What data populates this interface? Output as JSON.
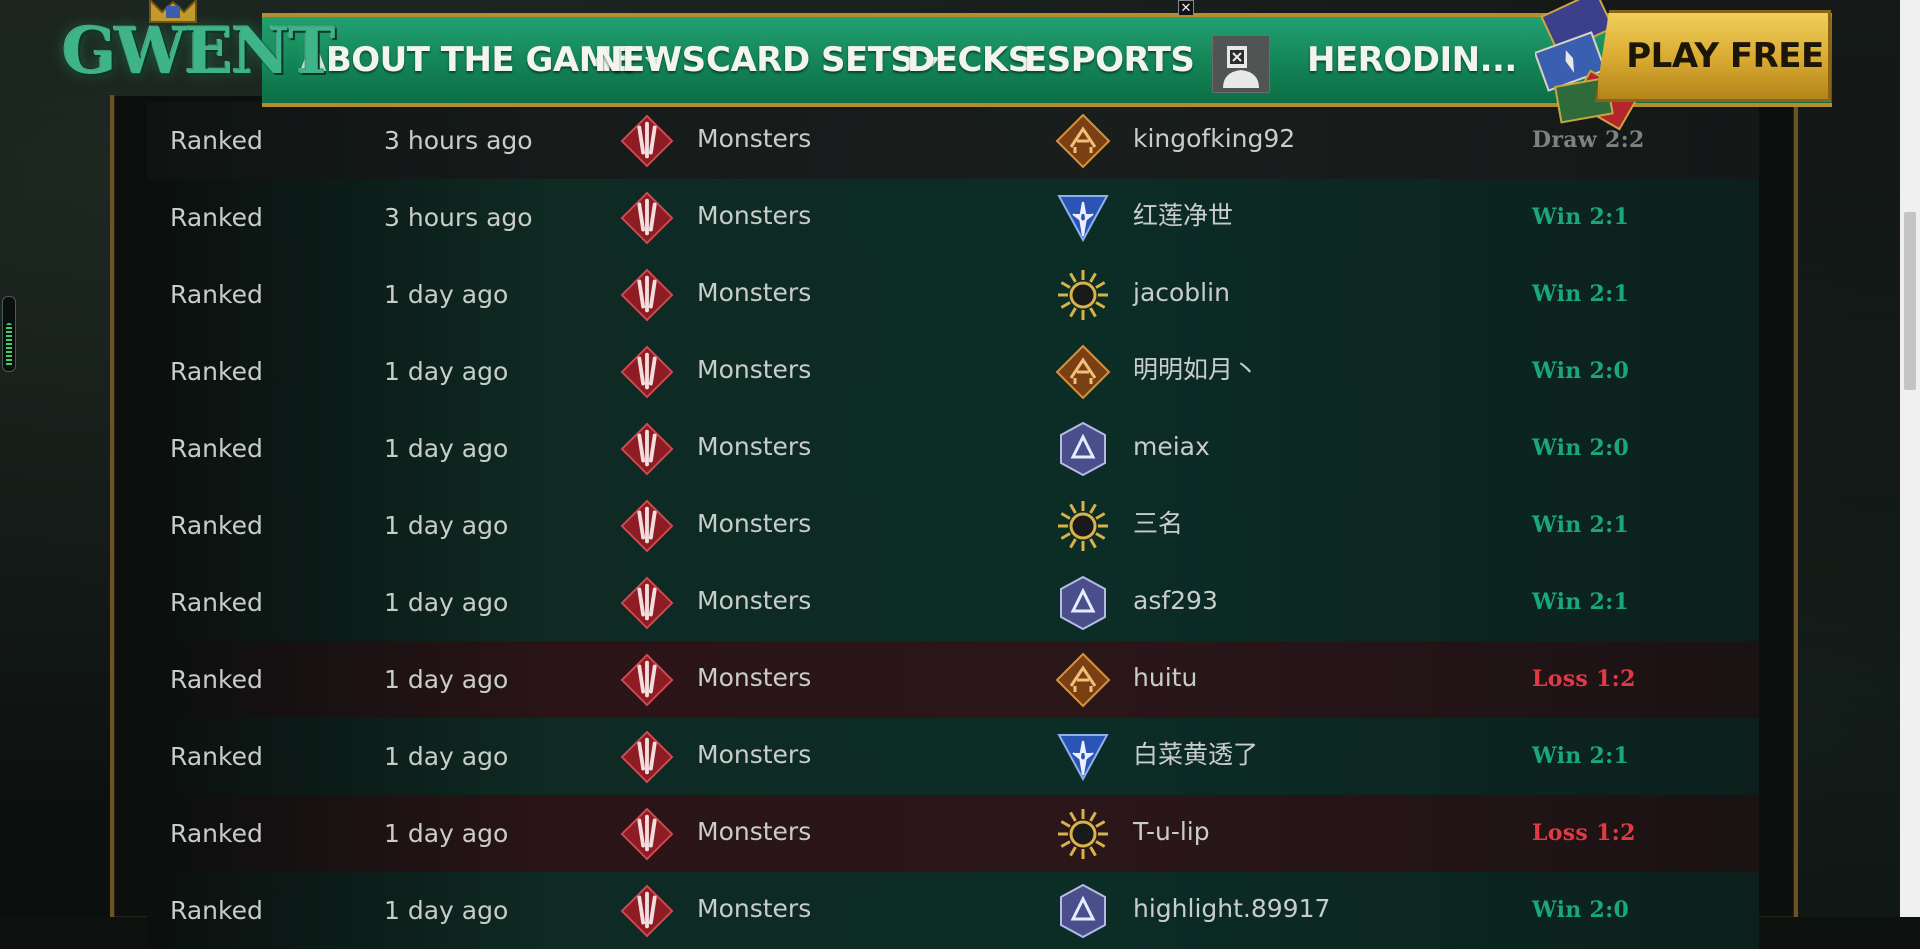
{
  "nav": {
    "logo": "GWENT",
    "items": [
      {
        "label": "ABOUT THE GAME",
        "dropdown": true
      },
      {
        "label": "NEWS",
        "dropdown": false
      },
      {
        "label": "CARD SETS",
        "dropdown": true
      },
      {
        "label": "DECKS",
        "dropdown": false
      },
      {
        "label": "ESPORTS",
        "dropdown": false
      }
    ],
    "username": "HERODIN...",
    "play_label": "PLAY FREE",
    "close_glyph": "✕"
  },
  "colors": {
    "nav_green": "#138455",
    "gold": "#d8a930",
    "win": "#1ba77e",
    "loss": "#e23a45",
    "draw": "#7d8380"
  },
  "matches": [
    {
      "mode": "Ranked",
      "time": "3 hours ago",
      "faction": "Monsters",
      "faction_icon": "monsters-icon",
      "opponent": "kingofking92",
      "opponent_icon": "syndicate-icon",
      "result": "Draw 2:2",
      "outcome": "draw"
    },
    {
      "mode": "Ranked",
      "time": "3 hours ago",
      "faction": "Monsters",
      "faction_icon": "monsters-icon",
      "opponent": "红莲净世",
      "opponent_icon": "northern-realms-icon",
      "result": "Win 2:1",
      "outcome": "win"
    },
    {
      "mode": "Ranked",
      "time": "1 day ago",
      "faction": "Monsters",
      "faction_icon": "monsters-icon",
      "opponent": "jacoblin",
      "opponent_icon": "nilfgaard-icon",
      "result": "Win 2:1",
      "outcome": "win"
    },
    {
      "mode": "Ranked",
      "time": "1 day ago",
      "faction": "Monsters",
      "faction_icon": "monsters-icon",
      "opponent": "明明如月丶",
      "opponent_icon": "syndicate-icon",
      "result": "Win 2:0",
      "outcome": "win"
    },
    {
      "mode": "Ranked",
      "time": "1 day ago",
      "faction": "Monsters",
      "faction_icon": "monsters-icon",
      "opponent": "meiax",
      "opponent_icon": "skellige-icon",
      "result": "Win 2:0",
      "outcome": "win"
    },
    {
      "mode": "Ranked",
      "time": "1 day ago",
      "faction": "Monsters",
      "faction_icon": "monsters-icon",
      "opponent": "三名",
      "opponent_icon": "nilfgaard-icon",
      "result": "Win 2:1",
      "outcome": "win"
    },
    {
      "mode": "Ranked",
      "time": "1 day ago",
      "faction": "Monsters",
      "faction_icon": "monsters-icon",
      "opponent": "asf293",
      "opponent_icon": "skellige-icon",
      "result": "Win 2:1",
      "outcome": "win"
    },
    {
      "mode": "Ranked",
      "time": "1 day ago",
      "faction": "Monsters",
      "faction_icon": "monsters-icon",
      "opponent": "huitu",
      "opponent_icon": "syndicate-icon",
      "result": "Loss 1:2",
      "outcome": "loss"
    },
    {
      "mode": "Ranked",
      "time": "1 day ago",
      "faction": "Monsters",
      "faction_icon": "monsters-icon",
      "opponent": "白菜黄透了",
      "opponent_icon": "northern-realms-icon",
      "result": "Win 2:1",
      "outcome": "win"
    },
    {
      "mode": "Ranked",
      "time": "1 day ago",
      "faction": "Monsters",
      "faction_icon": "monsters-icon",
      "opponent": "T-u-lip",
      "opponent_icon": "nilfgaard-icon",
      "result": "Loss 1:2",
      "outcome": "loss"
    },
    {
      "mode": "Ranked",
      "time": "1 day ago",
      "faction": "Monsters",
      "faction_icon": "monsters-icon",
      "opponent": "highlight.89917",
      "opponent_icon": "skellige-icon",
      "result": "Win 2:0",
      "outcome": "win"
    }
  ]
}
